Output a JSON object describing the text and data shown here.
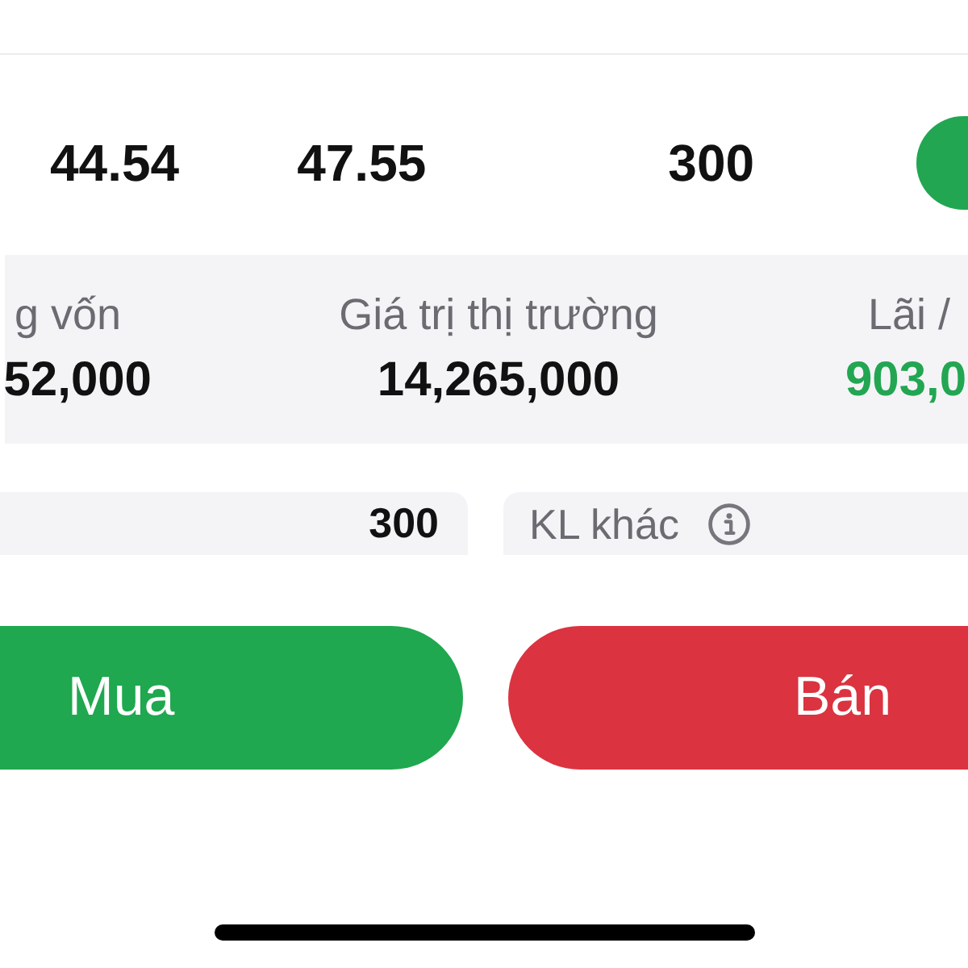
{
  "price_row": {
    "values": [
      "44.54",
      "47.55",
      "300"
    ]
  },
  "stats": [
    {
      "label": "g vốn",
      "value": "52,000",
      "color": "#111111"
    },
    {
      "label": "Giá trị thị trường",
      "value": "14,265,000",
      "color": "#111111"
    },
    {
      "label": "Lãi /",
      "value": "903,0",
      "color": "#22a652"
    }
  ],
  "quantity_cards": [
    {
      "kind": "value",
      "text": "300"
    },
    {
      "kind": "label",
      "text": "KL khác",
      "info_icon": true
    }
  ],
  "buttons": [
    {
      "kind": "buy",
      "label": "Mua"
    },
    {
      "kind": "sell",
      "label": "Bán"
    }
  ]
}
